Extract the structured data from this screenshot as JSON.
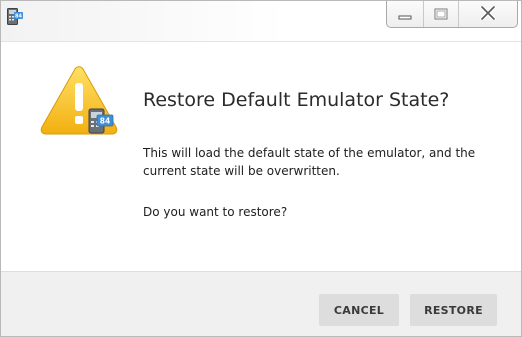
{
  "window": {
    "app_icon": "calculator-84-icon",
    "caption_buttons": {
      "minimize_icon": "minimize-icon",
      "maximize_icon": "maximize-icon",
      "close_icon": "close-icon"
    }
  },
  "dialog": {
    "icon": "warning-icon",
    "badge_icon": "calculator-84-icon",
    "badge_text": "84",
    "title": "Restore Default Emulator State?",
    "message": "This will load the default state of the emulator, and the current state will be overwritten.",
    "question": "Do you want to restore?"
  },
  "buttons": {
    "cancel_label": "CANCEL",
    "restore_label": "RESTORE"
  },
  "colors": {
    "warning_yellow": "#f5c518",
    "badge_blue": "#3f8fd8",
    "footer_bg": "#f0f0f0",
    "button_bg": "#dddddd"
  }
}
